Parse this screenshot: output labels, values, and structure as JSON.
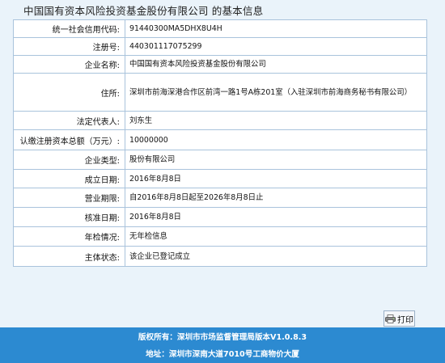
{
  "page": {
    "title": "中国国有资本风险投资基金股份有限公司 的基本信息"
  },
  "rows": [
    {
      "label": "统一社会信用代码:",
      "value": "91440300MA5DHX8U4H"
    },
    {
      "label": "注册号:",
      "value": "440301117075299"
    },
    {
      "label": "企业名称:",
      "value": "中国国有资本风险投资基金股份有限公司"
    },
    {
      "label": "住所:",
      "value": "深圳市前海深港合作区前湾一路1号A栋201室（入驻深圳市前海商务秘书有限公司）"
    },
    {
      "label": "法定代表人:",
      "value": "刘东生"
    },
    {
      "label": "认缴注册资本总额（万元）:",
      "value": "10000000"
    },
    {
      "label": "企业类型:",
      "value": "股份有限公司"
    },
    {
      "label": "成立日期:",
      "value": "2016年8月8日"
    },
    {
      "label": "营业期限:",
      "value": "自2016年8月8日起至2026年8月8日止"
    },
    {
      "label": "核准日期:",
      "value": "2016年8月8日"
    },
    {
      "label": "年检情况:",
      "value": "无年检信息"
    },
    {
      "label": "主体状态:",
      "value": "该企业已登记成立"
    }
  ],
  "actions": {
    "print_label": "打印",
    "print_icon": "printer-icon"
  },
  "footer": {
    "copyright": "版权所有：深圳市市场监督管理局版本V1.0.8.3",
    "address": "地址：深圳市深南大道7010号工商物价大厦"
  },
  "colors": {
    "background": "#eaf3fa",
    "border": "#a9c3dc",
    "footer": "#2c8ad1"
  }
}
